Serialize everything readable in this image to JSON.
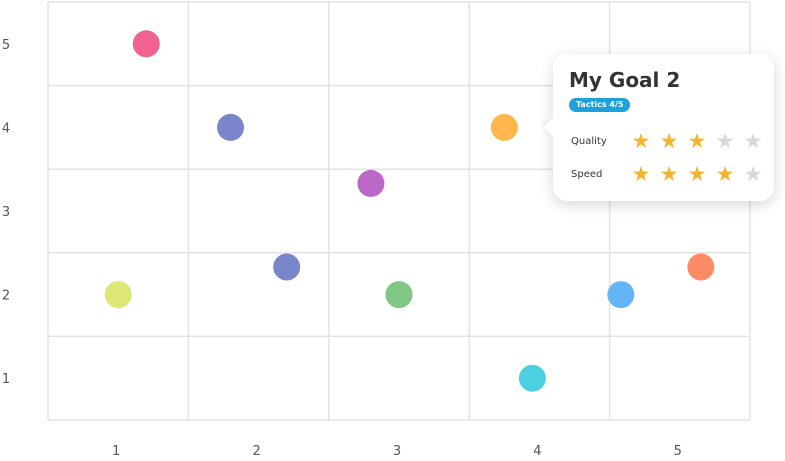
{
  "chart_data": {
    "type": "scatter",
    "x_ticks": [
      "1",
      "2",
      "3",
      "4",
      "5"
    ],
    "y_ticks": [
      "1",
      "2",
      "3",
      "4",
      "5"
    ],
    "xlim": [
      0.5,
      5.5
    ],
    "ylim": [
      0.5,
      5.5
    ],
    "grid": true,
    "points": [
      {
        "x": 1.2,
        "y": 5.0,
        "color": "#f06292"
      },
      {
        "x": 1.8,
        "y": 4.0,
        "color": "#7986cb"
      },
      {
        "x": 3.75,
        "y": 4.0,
        "color": "#ffb74d"
      },
      {
        "x": 2.8,
        "y": 3.33,
        "color": "#ba68c8"
      },
      {
        "x": 2.2,
        "y": 2.33,
        "color": "#7986cb"
      },
      {
        "x": 1.0,
        "y": 2.0,
        "color": "#dce775"
      },
      {
        "x": 3.0,
        "y": 2.0,
        "color": "#81c784"
      },
      {
        "x": 4.58,
        "y": 2.0,
        "color": "#64b5f6"
      },
      {
        "x": 5.15,
        "y": 2.33,
        "color": "#ff8a65"
      },
      {
        "x": 3.95,
        "y": 1.0,
        "color": "#4dd0e1"
      }
    ]
  },
  "tooltip": {
    "title": "My Goal 2",
    "badge": "Tactics 4/5",
    "badge_color": "#1ea0dc",
    "rows": [
      {
        "label": "Quality",
        "rating": 3,
        "max": 5
      },
      {
        "label": "Speed",
        "rating": 4,
        "max": 5
      }
    ],
    "star_on_color": "#f5b430",
    "star_off_color": "#d8d8d8"
  }
}
